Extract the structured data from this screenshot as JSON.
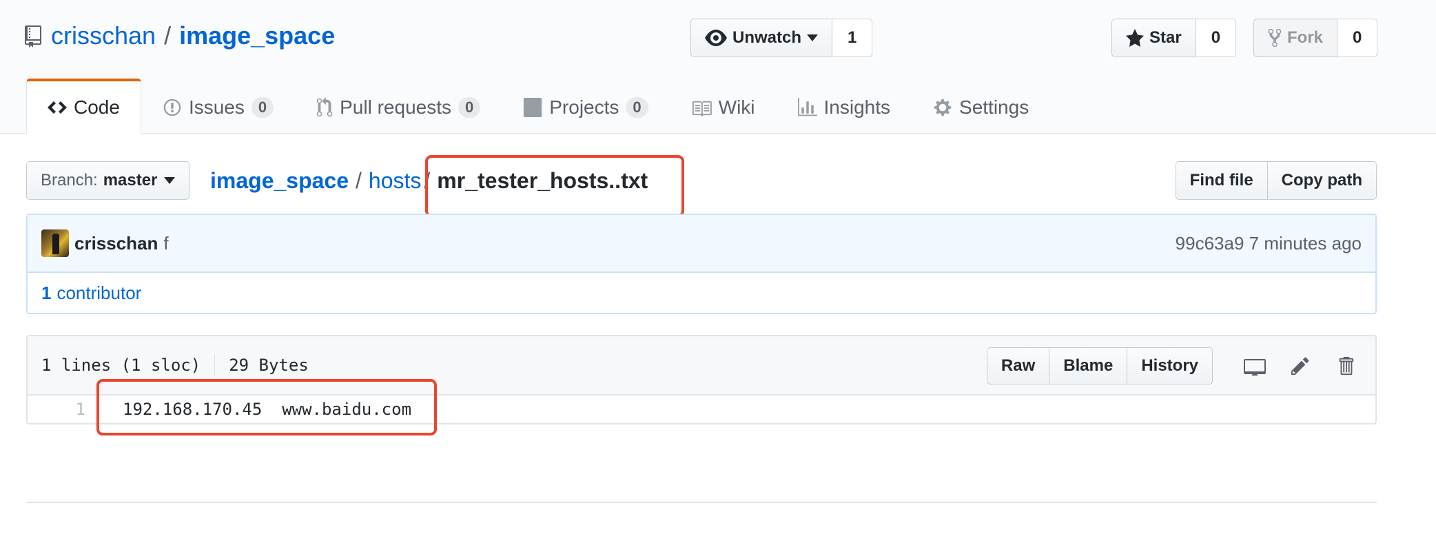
{
  "repo": {
    "owner": "crisschan",
    "separator": "/",
    "name": "image_space",
    "icon": "repo-icon"
  },
  "actions": {
    "watch": {
      "label": "Unwatch",
      "count": "1",
      "icon": "eye-icon"
    },
    "star": {
      "label": "Star",
      "count": "0",
      "icon": "star-icon"
    },
    "fork": {
      "label": "Fork",
      "count": "0",
      "icon": "fork-icon"
    }
  },
  "nav": {
    "code": {
      "label": "Code",
      "icon": "code-icon"
    },
    "issues": {
      "label": "Issues",
      "count": "0",
      "icon": "issue-icon"
    },
    "pulls": {
      "label": "Pull requests",
      "count": "0",
      "icon": "pull-request-icon"
    },
    "projects": {
      "label": "Projects",
      "count": "0",
      "icon": "project-icon"
    },
    "wiki": {
      "label": "Wiki",
      "icon": "book-icon"
    },
    "insights": {
      "label": "Insights",
      "icon": "graph-icon"
    },
    "settings": {
      "label": "Settings",
      "icon": "gear-icon"
    }
  },
  "file_nav": {
    "branch_prefix": "Branch:",
    "branch": "master",
    "breadcrumb": {
      "root": "image_space",
      "folder": "hosts",
      "separator": "/",
      "file": "mr_tester_hosts..txt"
    },
    "find_file": "Find file",
    "copy_path": "Copy path"
  },
  "commit": {
    "author": "crisschan",
    "message": "f",
    "sha": "99c63a9",
    "time": "7 minutes ago",
    "contributors_count": "1",
    "contributors_label": "contributor"
  },
  "file": {
    "lines_info": "1 lines (1 sloc)",
    "size": "29 Bytes",
    "raw": "Raw",
    "blame": "Blame",
    "history": "History",
    "tool_icons": [
      "desktop-icon",
      "pencil-icon",
      "trash-icon"
    ],
    "lines": [
      {
        "num": "1",
        "code": "192.168.170.45  www.baidu.com"
      }
    ]
  },
  "colors": {
    "link": "#0366d6",
    "highlight": "#e8462f",
    "selected_tab": "#e36209"
  }
}
